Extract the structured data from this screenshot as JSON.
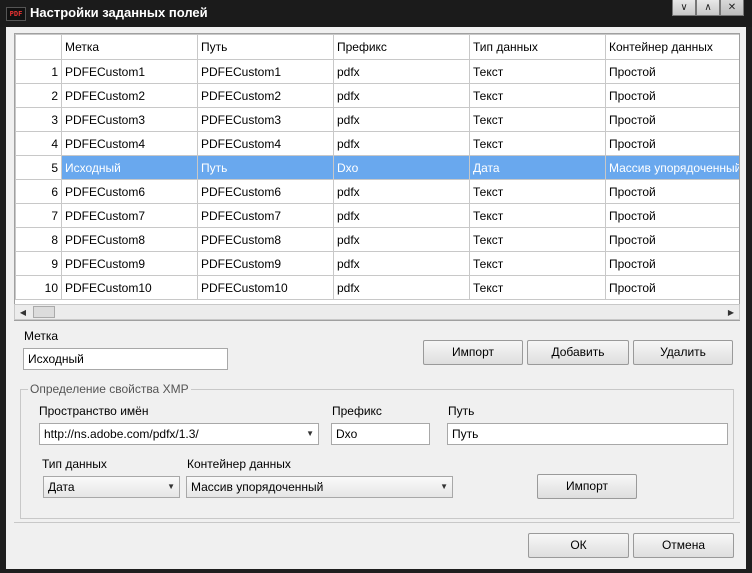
{
  "window": {
    "title": "Настройки заданных полей",
    "app_icon_text": "PDF",
    "buttons": [
      "∨",
      "∧",
      "✕"
    ]
  },
  "grid": {
    "columns": [
      "Метка",
      "Путь",
      "Префикс",
      "Тип данных",
      "Контейнер данных"
    ],
    "rows": [
      {
        "num": "1",
        "cells": [
          "PDFECustom1",
          "PDFECustom1",
          "pdfx",
          "Текст",
          "Простой"
        ]
      },
      {
        "num": "2",
        "cells": [
          "PDFECustom2",
          "PDFECustom2",
          "pdfx",
          "Текст",
          "Простой"
        ]
      },
      {
        "num": "3",
        "cells": [
          "PDFECustom3",
          "PDFECustom3",
          "pdfx",
          "Текст",
          "Простой"
        ]
      },
      {
        "num": "4",
        "cells": [
          "PDFECustom4",
          "PDFECustom4",
          "pdfx",
          "Текст",
          "Простой"
        ]
      },
      {
        "num": "5",
        "cells": [
          "Исходный",
          "Путь",
          "Dxo",
          "Дата",
          "Массив упорядоченный"
        ]
      },
      {
        "num": "6",
        "cells": [
          "PDFECustom6",
          "PDFECustom6",
          "pdfx",
          "Текст",
          "Простой"
        ]
      },
      {
        "num": "7",
        "cells": [
          "PDFECustom7",
          "PDFECustom7",
          "pdfx",
          "Текст",
          "Простой"
        ]
      },
      {
        "num": "8",
        "cells": [
          "PDFECustom8",
          "PDFECustom8",
          "pdfx",
          "Текст",
          "Простой"
        ]
      },
      {
        "num": "9",
        "cells": [
          "PDFECustom9",
          "PDFECustom9",
          "pdfx",
          "Текст",
          "Простой"
        ]
      },
      {
        "num": "10",
        "cells": [
          "PDFECustom10",
          "PDFECustom10",
          "pdfx",
          "Текст",
          "Простой"
        ]
      }
    ],
    "selected_row": 5,
    "scroll_left": "◀",
    "scroll_right": "▶"
  },
  "label_section": {
    "label": "Метка",
    "value": "Исходный",
    "import_button": "Импорт",
    "add_button": "Добавить",
    "delete_button": "Удалить"
  },
  "xmp": {
    "group_title": "Определение свойства XMP",
    "namespace_label": "Пространство имён",
    "namespace_value": "http://ns.adobe.com/pdfx/1.3/",
    "prefix_label": "Префикс",
    "prefix_value": "Dxo",
    "path_label": "Путь",
    "path_value": "Путь",
    "datatype_label": "Тип данных",
    "datatype_value": "Дата",
    "container_label": "Контейнер данных",
    "container_value": "Массив упорядоченный",
    "import_button": "Импорт"
  },
  "footer": {
    "ok_button": "ОК",
    "cancel_button": "Отмена"
  },
  "colors": {
    "selection": "#69a8ee",
    "title_bar": "#1b1b1b"
  }
}
